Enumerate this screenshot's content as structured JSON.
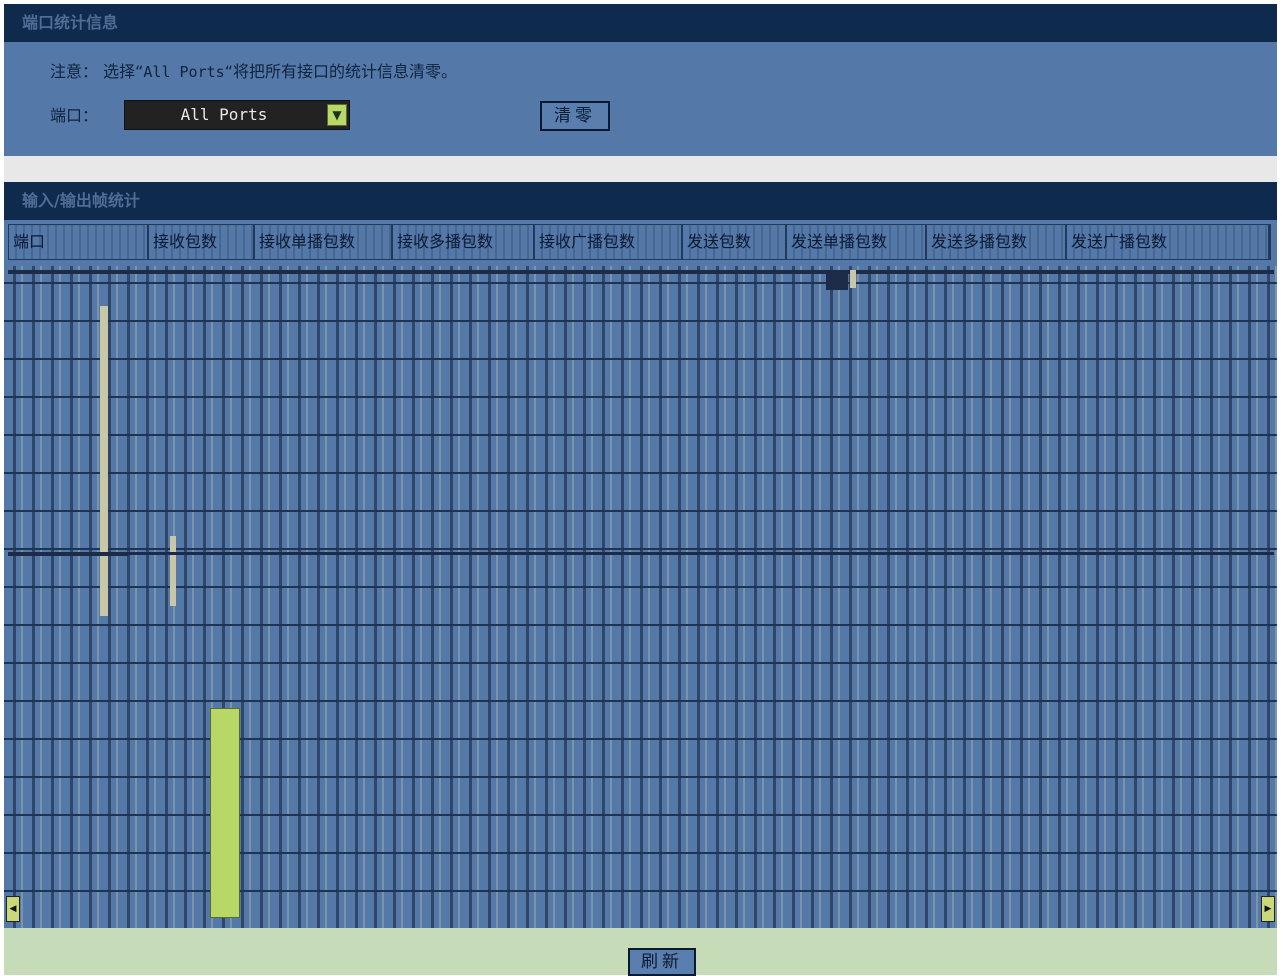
{
  "port_stats": {
    "title": "端口统计信息",
    "note_label": "注意：",
    "note_text_pre": "选择“",
    "note_text_code": "All Ports",
    "note_text_post": "“将把所有接口的统计信息清零。",
    "port_label": "端口：",
    "port_selected": "All Ports",
    "clear_button": "清零"
  },
  "io_stats": {
    "title": "输入/输出帧统计",
    "columns": [
      "端口",
      "接收包数",
      "接收单播包数",
      "接收多播包数",
      "接收广播包数",
      "发送包数",
      "发送单播包数",
      "发送多播包数",
      "发送广播包数"
    ]
  },
  "footer": {
    "refresh_button": "刷新"
  },
  "colors": {
    "header_bg": "#0e2a4c",
    "panel_bg": "#5478a8",
    "accent_green": "#b7d867",
    "footer_bg": "#c6dcb8"
  }
}
